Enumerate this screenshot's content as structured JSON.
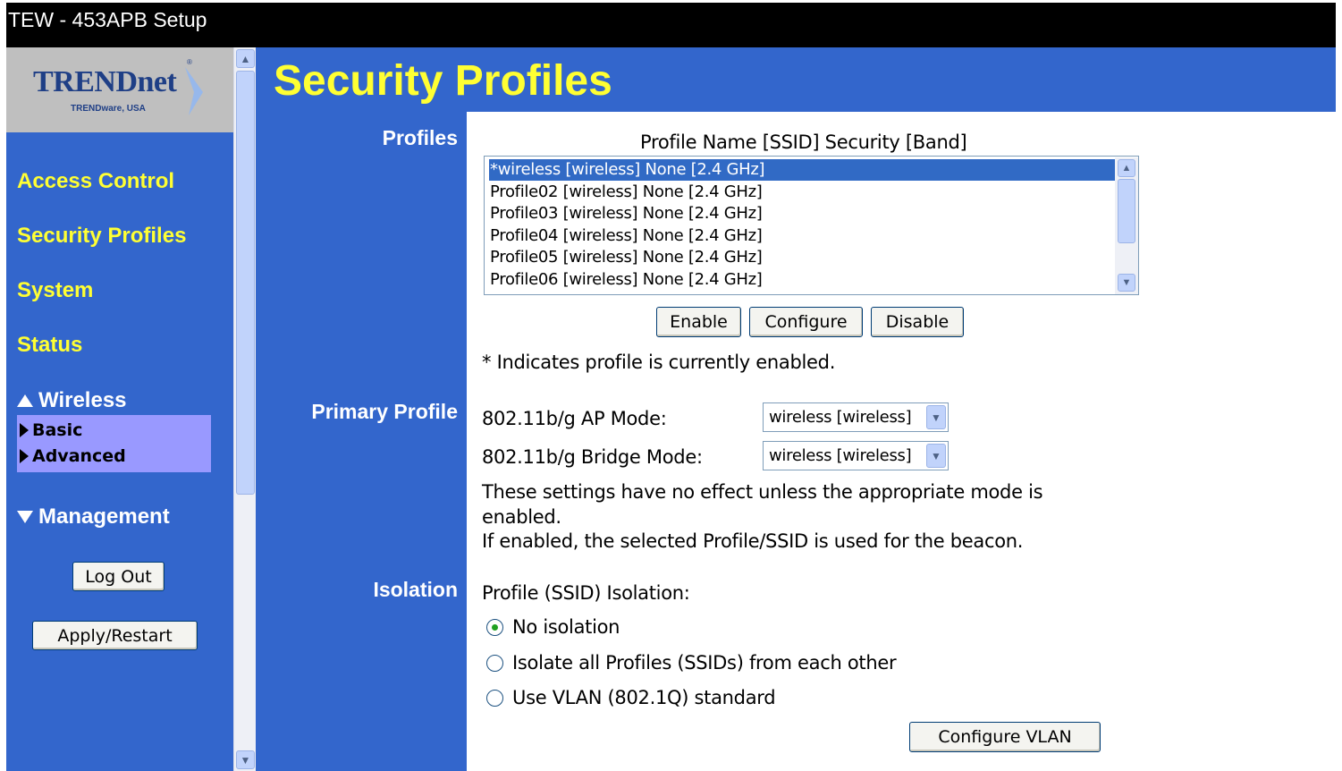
{
  "window": {
    "title": "TEW - 453APB Setup"
  },
  "logo": {
    "brand": "TRENDnet",
    "sub": "TRENDware, USA",
    "reg": "®"
  },
  "sidebar": {
    "links": [
      "Access Control",
      "Security Profiles",
      "System",
      "Status"
    ],
    "wireless": {
      "label": "Wireless",
      "items": [
        "Basic",
        "Advanced"
      ]
    },
    "management": {
      "label": "Management"
    },
    "logout_label": "Log Out",
    "apply_label": "Apply/Restart"
  },
  "main": {
    "title": "Security Profiles",
    "sections": {
      "profiles": "Profiles",
      "primary": "Primary Profile",
      "isolation": "Isolation"
    },
    "profiles": {
      "column_header": "Profile Name [SSID] Security [Band]",
      "items": [
        "*wireless [wireless] None [2.4 GHz]",
        "Profile02 [wireless] None [2.4 GHz]",
        "Profile03 [wireless] None [2.4 GHz]",
        "Profile04 [wireless] None [2.4 GHz]",
        "Profile05 [wireless] None [2.4 GHz]",
        "Profile06 [wireless] None [2.4 GHz]"
      ],
      "selected_index": 0,
      "buttons": {
        "enable": "Enable",
        "configure": "Configure",
        "disable": "Disable"
      },
      "note": "* Indicates profile is currently enabled."
    },
    "primary": {
      "ap_mode_label": "802.11b/g AP Mode:",
      "ap_mode_value": "wireless [wireless]",
      "bridge_mode_label": "802.11b/g Bridge Mode:",
      "bridge_mode_value": "wireless [wireless]",
      "note_line1": "These settings have no effect unless the appropriate mode is",
      "note_line2": "enabled.",
      "note_line3": "If enabled, the selected Profile/SSID is used for the beacon."
    },
    "isolation": {
      "heading": "Profile (SSID) Isolation:",
      "options": [
        "No isolation",
        "Isolate all Profiles (SSIDs) from each other",
        "Use VLAN (802.1Q) standard"
      ],
      "selected_index": 0,
      "configure_vlan_label": "Configure VLAN"
    }
  },
  "colors": {
    "frame_blue": "#3366cc",
    "link_yellow": "#ffff33",
    "subnav_purple": "#9999ff",
    "selection_blue": "#316ac5"
  }
}
